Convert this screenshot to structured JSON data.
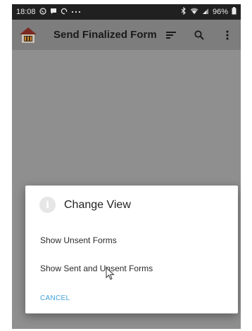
{
  "status_bar": {
    "time": "18:08",
    "battery": "96%"
  },
  "app_bar": {
    "title": "Send Finalized Form"
  },
  "dialog": {
    "title": "Change View",
    "options": [
      "Show Unsent Forms",
      "Show Sent and Unsent Forms"
    ],
    "cancel_label": "CANCEL"
  },
  "colors": {
    "status_bar": "#202020",
    "app_bar_dimmed": "#7d7d7d",
    "scrim": "#8f8f8f",
    "dialog_bg": "#ffffff",
    "cancel_accent": "#3aa0d8"
  },
  "icons": [
    "whatsapp-icon",
    "message-icon",
    "sync-icon",
    "more-notifications-icon",
    "bluetooth-icon",
    "wifi-icon",
    "signal-icon",
    "battery-icon",
    "app-logo-icon",
    "sort-icon",
    "search-icon",
    "overflow-menu-icon",
    "info-icon",
    "mouse-cursor-icon"
  ]
}
